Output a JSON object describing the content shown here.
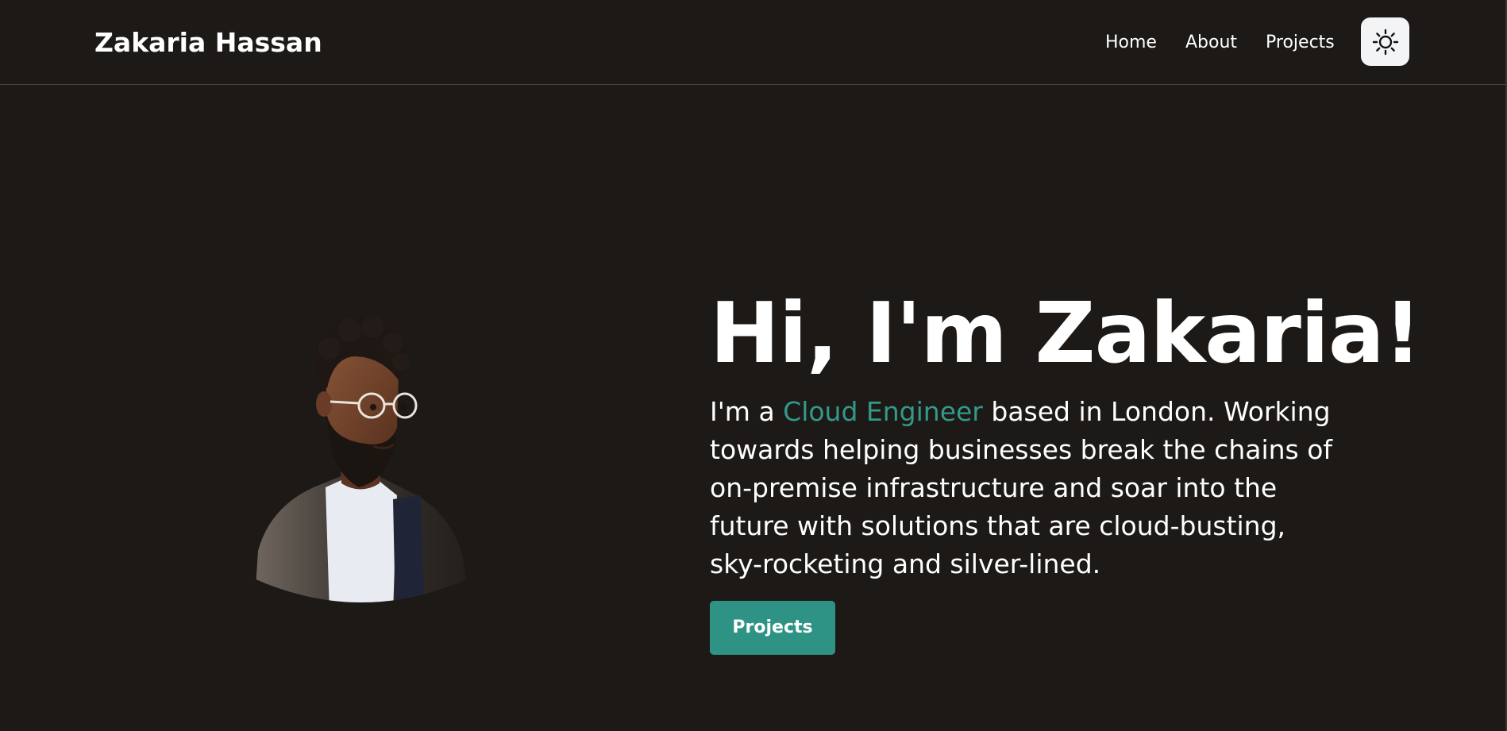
{
  "header": {
    "brand": "Zakaria Hassan",
    "nav": [
      {
        "label": "Home"
      },
      {
        "label": "About"
      },
      {
        "label": "Projects"
      }
    ],
    "theme_toggle_icon": "sun-icon"
  },
  "hero": {
    "title": "Hi, I'm Zakaria!",
    "intro_prefix": "I'm a ",
    "intro_highlight": "Cloud Engineer",
    "intro_suffix": " based in London. Working towards helping businesses break the chains of on-premise infrastructure and soar into the future with solutions that are cloud-busting, sky-rocketing and silver-lined.",
    "cta_label": "Projects",
    "avatar_icon": "avatar-portrait"
  },
  "colors": {
    "background": "#1d1917",
    "accent": "#33998a",
    "button": "#2e9384",
    "toggle_bg": "#f3f4f6"
  }
}
